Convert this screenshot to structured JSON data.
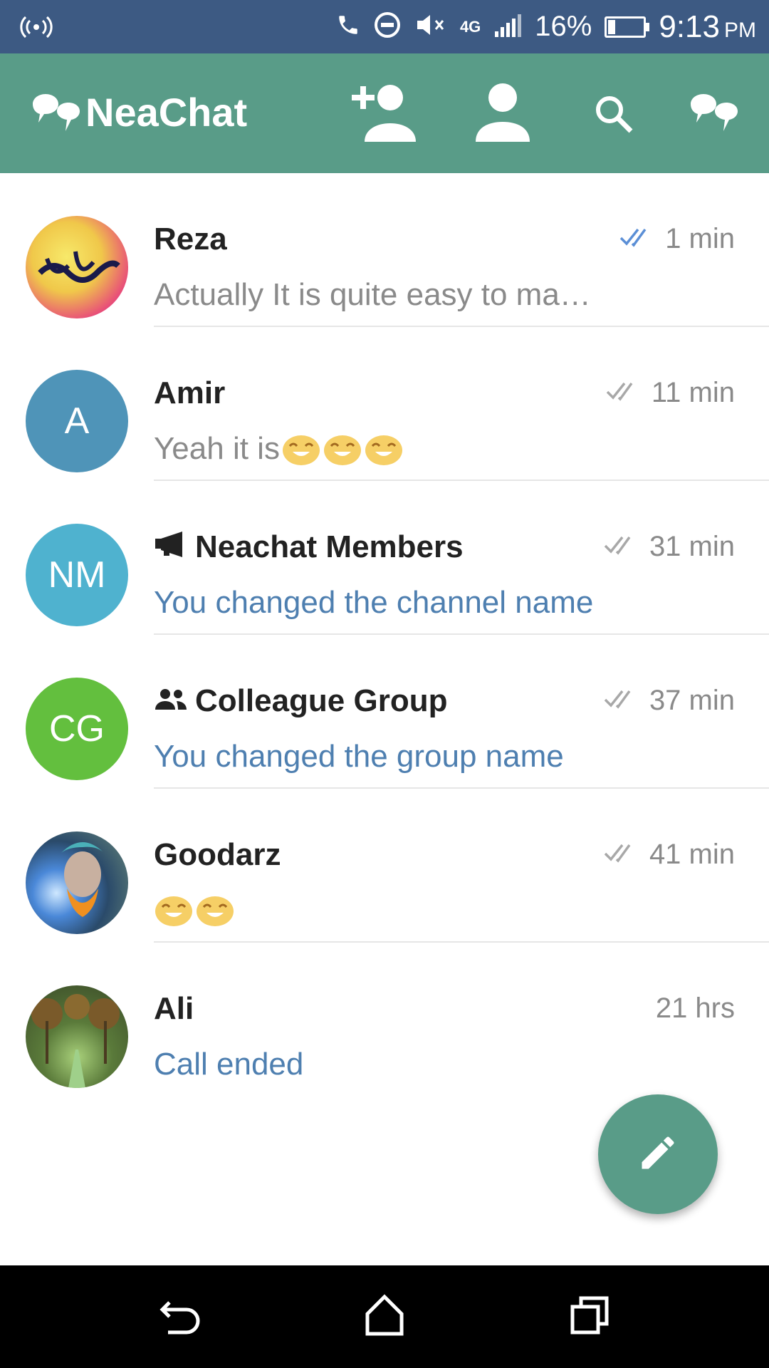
{
  "status_bar": {
    "network": "4G",
    "battery": "16%",
    "time": "9:13",
    "ampm": "PM"
  },
  "app_bar": {
    "title": "NeaChat",
    "icons": [
      "add-contact-icon",
      "contacts-icon",
      "search-icon",
      "neachat-logo-icon"
    ]
  },
  "chats": [
    {
      "name": "Reza",
      "time": "1 min",
      "message": "Actually It is quite easy to ma…",
      "check": "read",
      "avatar": "photo"
    },
    {
      "name": "Amir",
      "time": "11 min",
      "message": "Yeah it is",
      "check": "sent",
      "avatar_initials": "A",
      "avatar_color": "#4f94b8"
    },
    {
      "name": "Neachat Members",
      "time": "31 min",
      "message": "You changed the channel name",
      "check": "sent",
      "avatar_initials": "NM",
      "avatar_color": "#4fb2cf",
      "type_icon": "megaphone-icon"
    },
    {
      "name": "Colleague Group",
      "time": "37 min",
      "message": "You changed the group name",
      "check": "sent",
      "avatar_initials": "CG",
      "avatar_color": "#63bf3e",
      "type_icon": "group-icon"
    },
    {
      "name": "Goodarz",
      "time": "41 min",
      "message": "",
      "check": "sent",
      "avatar": "photo"
    },
    {
      "name": "Ali",
      "time": "21 hrs",
      "message": "Call ended",
      "avatar": "photo"
    }
  ],
  "colors": {
    "status_bar": "#3d5a83",
    "app_bar": "#599c88",
    "service_text": "#4e7fb0",
    "read_check": "#5b8fd6"
  },
  "fab": {
    "icon": "pencil-icon"
  }
}
